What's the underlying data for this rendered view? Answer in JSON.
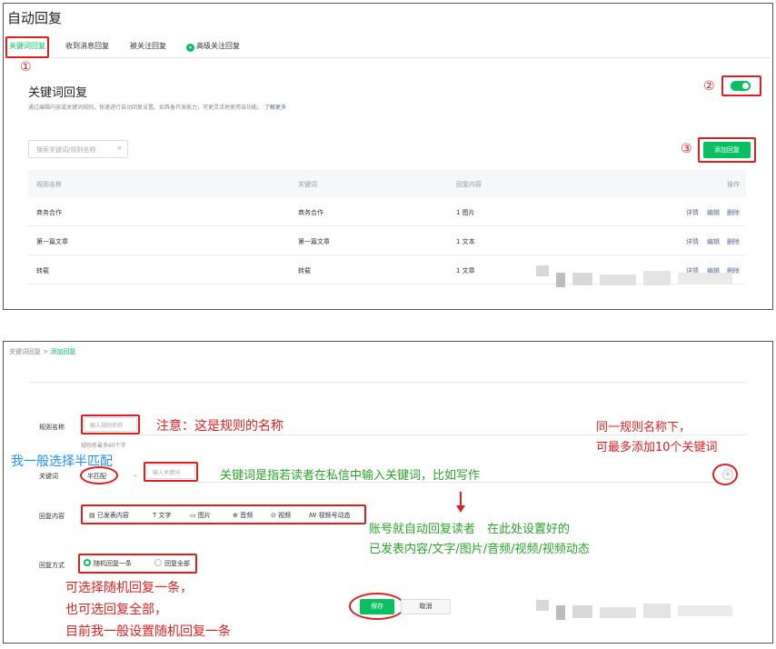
{
  "top": {
    "page_title": "自动回复",
    "tabs": [
      {
        "label": "关键词回复"
      },
      {
        "label": "收到消息回复"
      },
      {
        "label": "被关注回复"
      },
      {
        "label": "高级关注回复"
      }
    ],
    "section_title": "关键词回复",
    "section_desc": "通过编辑内容或关键词规则，快速进行自动回复设置。如具备开发能力，可更灵活地使用该功能。",
    "learn_more": "了解更多",
    "search_placeholder": "搜索关键词/规则名称",
    "add_button": "添加回复",
    "annotations": {
      "one": "①",
      "two": "②",
      "three": "③"
    },
    "table": {
      "headers": [
        "规则名称",
        "关键词",
        "回复内容",
        "操作"
      ],
      "rows": [
        {
          "name": "商务合作",
          "keyword": "商务合作",
          "reply": "1 图片",
          "detail": "详情",
          "edit": "编辑",
          "delete": "删除"
        },
        {
          "name": "第一篇文章",
          "keyword": "第一篇文章",
          "reply": "1 文本",
          "detail": "详情",
          "edit": "编辑",
          "delete": "删除"
        },
        {
          "name": "转载",
          "keyword": "转载",
          "reply": "1 文章",
          "detail": "详情",
          "edit": "编辑",
          "delete": "删除"
        }
      ]
    }
  },
  "bottom": {
    "breadcrumb": {
      "parent": "关键词回复",
      "sep": ">",
      "current": "添加回复"
    },
    "rule_name_label": "规则名称",
    "rule_name_placeholder": "输入规则名称",
    "rule_name_hint": "规则名最多60个字",
    "keyword_label": "关键词",
    "match_mode": "半匹配",
    "keyword_placeholder": "输入关键词",
    "reply_label": "回复内容",
    "reply_types": [
      "已发表内容",
      "文字",
      "图片",
      "音频",
      "视频",
      "视频号动态"
    ],
    "reply_mode_label": "回复方式",
    "reply_modes": [
      "随机回复一条",
      "回复全部"
    ],
    "save": "保存",
    "cancel": "取消",
    "add_keyword": "+",
    "notes": {
      "rule_name": "注意：这是规则的名称",
      "limit_1": "同一规则名称下，",
      "limit_2": "可最多添加10个关键词",
      "match": "我一般选择半匹配",
      "keyword_desc": "关键词是指若读者在私信中输入关键词，比如写作",
      "auto_1": "账号就自动回复读者　在此处设置好的",
      "auto_2": "已发表内容/文字/图片/音频/视频/视频动态",
      "mode_1": "可选择随机回复一条，",
      "mode_2": "也可选回复全部，",
      "mode_3": "目前我一般设置随机回复一条"
    }
  },
  "colors": {
    "accent": "#07c160",
    "annotation": "#e02020",
    "link": "#576b95",
    "note_blue": "#1e90ff",
    "note_green": "#2aa52a"
  }
}
